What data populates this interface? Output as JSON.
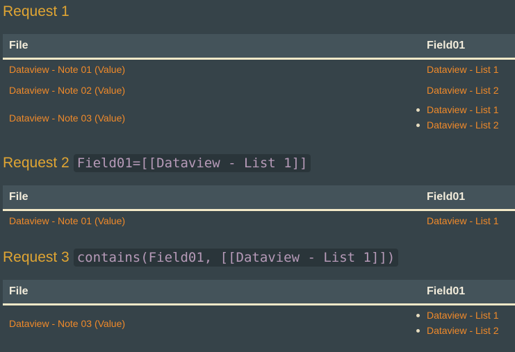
{
  "requests": [
    {
      "title": "Request 1",
      "query": "",
      "columns": {
        "file": "File",
        "field": "Field01"
      },
      "rows": [
        {
          "file": "Dataview - Note 01 (Value)",
          "field": [
            "Dataview - List 1"
          ]
        },
        {
          "file": "Dataview - Note 02 (Value)",
          "field": [
            "Dataview - List 2"
          ]
        },
        {
          "file": "Dataview - Note 03 (Value)",
          "field": [
            "Dataview - List 1",
            "Dataview - List 2"
          ]
        }
      ]
    },
    {
      "title": "Request 2",
      "query": "Field01=[[Dataview - List 1]]",
      "columns": {
        "file": "File",
        "field": "Field01"
      },
      "rows": [
        {
          "file": "Dataview - Note 01 (Value)",
          "field": [
            "Dataview - List 1"
          ]
        }
      ]
    },
    {
      "title": "Request 3",
      "query": "contains(Field01, [[Dataview - List 1]])",
      "columns": {
        "file": "File",
        "field": "Field01"
      },
      "rows": [
        {
          "file": "Dataview - Note 03 (Value)",
          "field": [
            "Dataview - List 1",
            "Dataview - List 2"
          ]
        }
      ]
    }
  ],
  "colors": {
    "background": "#364349",
    "heading": "#e0a533",
    "link": "#f08a2a",
    "header_text": "#f2ecdb",
    "code_text": "#b69ab8"
  }
}
